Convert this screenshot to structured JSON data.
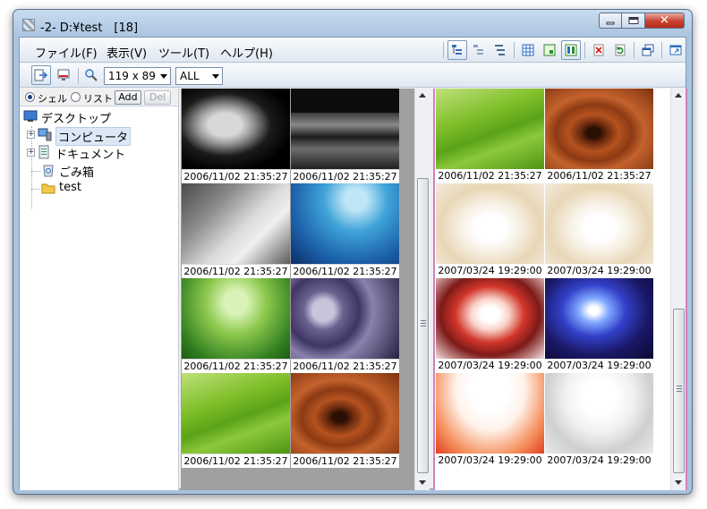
{
  "window": {
    "title": "-2- D:¥test　[18]"
  },
  "menu": {
    "items": [
      "ファイル(F)",
      "表示(V)",
      "ツール(T)",
      "ヘルプ(H)"
    ]
  },
  "toolbar": {
    "size_value": "119 x 89",
    "filter_value": "ALL"
  },
  "tree_mode": {
    "shell_label": "シェル",
    "list_label": "リスト",
    "selected": "シェル",
    "add_label": "Add",
    "del_label": "Del"
  },
  "tree": {
    "root": "デスクトップ",
    "computer": "コンピュータ",
    "documents": "ドキュメント",
    "trash": "ごみ箱",
    "test": "test"
  },
  "left_panel": {
    "thumbs": [
      {
        "caption": "2006/11/02 21:35:27",
        "kind": "leaf"
      },
      {
        "caption": "2006/11/02 21:35:27",
        "kind": "city"
      },
      {
        "caption": "2006/11/02 21:35:27",
        "kind": "tree"
      },
      {
        "caption": "2006/11/02 21:35:27",
        "kind": "fish"
      },
      {
        "caption": "2006/11/02 21:35:27",
        "kind": "grass"
      },
      {
        "caption": "2006/11/02 21:35:27",
        "kind": "stones"
      },
      {
        "caption": "2006/11/02 21:35:27",
        "kind": "banana"
      },
      {
        "caption": "2006/11/02 21:35:27",
        "kind": "wood"
      }
    ]
  },
  "right_panel": {
    "thumbs": [
      {
        "caption": "2006/11/02 21:35:27",
        "kind": "banana"
      },
      {
        "caption": "2006/11/02 21:35:27",
        "kind": "wood"
      },
      {
        "caption": "2007/03/24 19:29:00",
        "kind": "cloud"
      },
      {
        "caption": "2007/03/24 19:29:00",
        "kind": "cloud"
      },
      {
        "caption": "2007/03/24 19:29:00",
        "kind": "burst"
      },
      {
        "caption": "2007/03/24 19:29:00",
        "kind": "blue"
      },
      {
        "caption": "2007/03/24 19:29:00",
        "kind": "glow"
      },
      {
        "caption": "2007/03/24 19:29:00",
        "kind": "ray"
      }
    ]
  },
  "icons": {
    "right_toolbar": [
      "tree-view-icon",
      "tree-view-alt-icon",
      "tree-sort-icon",
      "grid-view-icon",
      "single-view-icon",
      "dual-view-icon",
      "delete-icon",
      "refresh-icon",
      "new-window-icon",
      "popout-icon"
    ]
  },
  "colors": {
    "panel_b_border": "#d77cc0",
    "panel_a_bg": "#a0a0a0"
  }
}
